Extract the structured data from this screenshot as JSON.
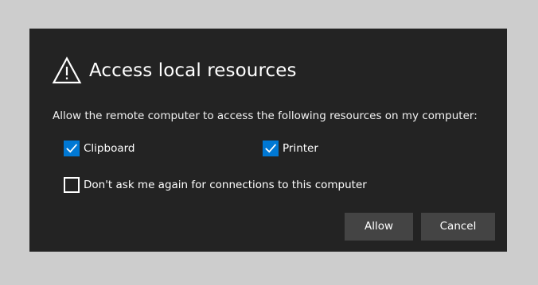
{
  "dialog": {
    "title": "Access local resources",
    "description": "Allow the remote computer to access the following resources on my computer:",
    "options": {
      "clipboard": {
        "label": "Clipboard",
        "checked": true
      },
      "printer": {
        "label": "Printer",
        "checked": true
      },
      "dont_ask": {
        "label": "Don't ask me again for connections to this computer",
        "checked": false
      }
    },
    "buttons": {
      "allow": "Allow",
      "cancel": "Cancel"
    }
  },
  "colors": {
    "background": "#cdcdcd",
    "dialog_background": "#232323",
    "button_background": "#444444",
    "checkbox_accent": "#0078d4",
    "text": "#ffffff"
  },
  "icons": {
    "header": "warning-icon",
    "checked": "checkmark-icon"
  }
}
